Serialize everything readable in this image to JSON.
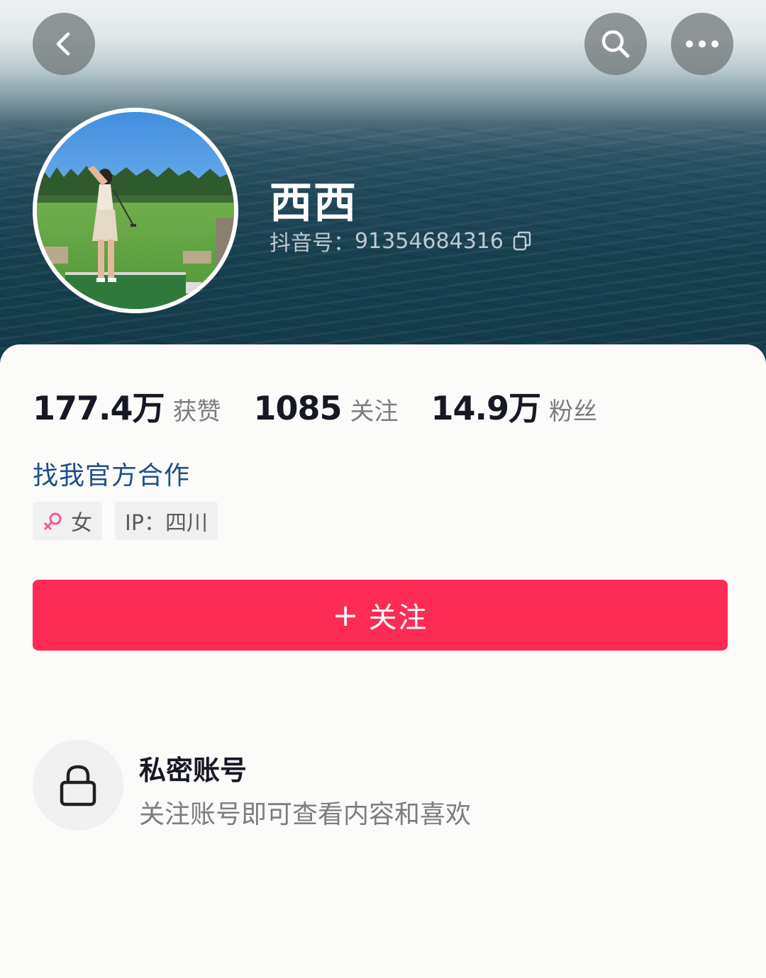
{
  "header": {
    "username": "西西",
    "account_id_label": "抖音号：",
    "account_id": "91354684316",
    "icons": [
      "back-icon",
      "search-icon",
      "more-icon",
      "copy-icon"
    ]
  },
  "stats": [
    {
      "value": "177.4万",
      "label": "获赞"
    },
    {
      "value": "1085",
      "label": "关注"
    },
    {
      "value": "14.9万",
      "label": "粉丝"
    }
  ],
  "cooperation_link": "找我官方合作",
  "tags": {
    "gender": "女",
    "ip": "IP：四川"
  },
  "follow_button": {
    "plus": "+",
    "label": "关注",
    "color": "#fe2c55"
  },
  "private_notice": {
    "title": "私密账号",
    "description": "关注账号即可查看内容和喜欢",
    "icon": "lock-icon"
  },
  "colors": {
    "link": "#1f4e8c",
    "primary_text": "#161823",
    "secondary_text": "#7c7d82"
  }
}
